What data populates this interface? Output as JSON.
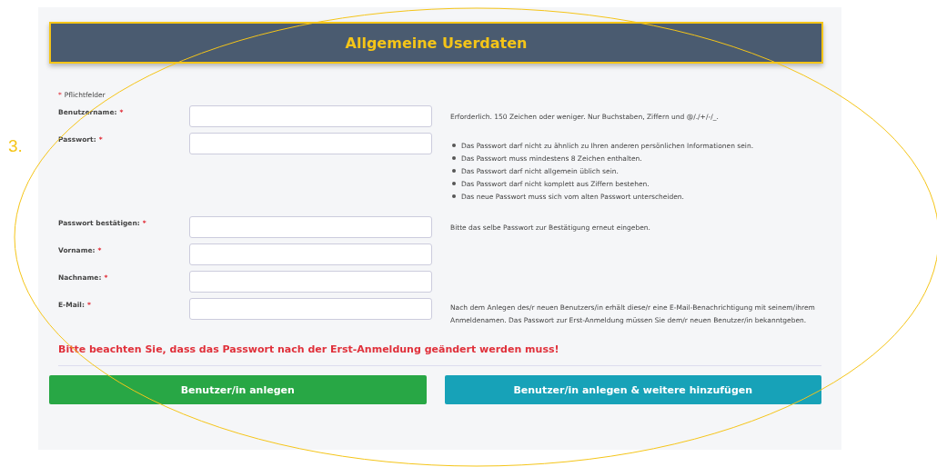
{
  "annotation": {
    "number": "3."
  },
  "header": {
    "title": "Allgemeine Userdaten"
  },
  "required_note": {
    "mark": "*",
    "text": "Pflichtfelder"
  },
  "fields": [
    {
      "label": "Benutzername:",
      "required": true,
      "help": {
        "kind": "text",
        "text": "Erforderlich. 150 Zeichen oder weniger. Nur Buchstaben, Ziffern und @/./+/-/_."
      }
    },
    {
      "label": "Passwort:",
      "required": true,
      "help": {
        "kind": "list",
        "items": [
          "Das Passwort darf nicht zu ähnlich zu Ihren anderen persönlichen Informationen sein.",
          "Das Passwort muss mindestens 8 Zeichen enthalten.",
          "Das Passwort darf nicht allgemein üblich sein.",
          "Das Passwort darf nicht komplett aus Ziffern bestehen.",
          "Das neue Passwort muss sich vom alten Passwort unterscheiden."
        ]
      }
    },
    {
      "label": "Passwort bestätigen:",
      "required": true,
      "help": {
        "kind": "text",
        "text": "Bitte das selbe Passwort zur Bestätigung erneut eingeben."
      }
    },
    {
      "label": "Vorname:",
      "required": true
    },
    {
      "label": "Nachname:",
      "required": true
    },
    {
      "label": "E-Mail:",
      "required": true,
      "help": {
        "kind": "text",
        "text": "Nach dem Anlegen des/r neuen Benutzers/in erhält diese/r eine E-Mail-Benachrichtigung mit seinem/ihrem Anmeldenamen. Das Passwort zur Erst-Anmeldung müssen Sie dem/r neuen Benutzer/in bekanntgeben."
      }
    }
  ],
  "warning": "Bitte beachten Sie, dass das Passwort nach der Erst-Anmeldung geändert werden muss!",
  "buttons": [
    {
      "label": "Benutzer/in anlegen",
      "kind": "success"
    },
    {
      "label": "Benutzer/in anlegen & weitere hinzufügen",
      "kind": "info"
    }
  ]
}
